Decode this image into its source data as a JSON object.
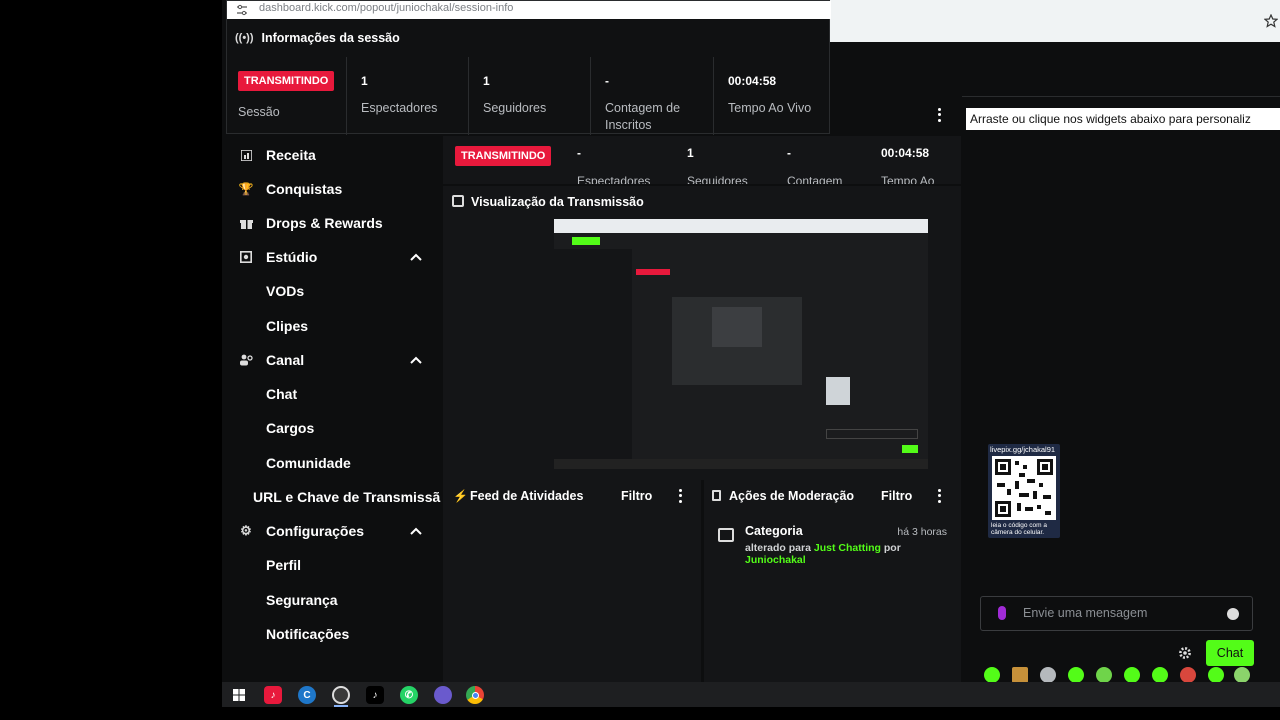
{
  "popup": {
    "url": "dashboard.kick.com/popout/juniochakal/session-info",
    "title": "Informações da sessão",
    "live_badge": "TRANSMITINDO",
    "session_label": "Sessão",
    "stats": [
      {
        "value": "1",
        "label": "Espectadores"
      },
      {
        "value": "1",
        "label": "Seguidores"
      },
      {
        "value": "-",
        "label": "Contagem de Inscritos"
      },
      {
        "value": "00:04:58",
        "label": "Tempo Ao Vivo"
      }
    ]
  },
  "sidebar": {
    "items": [
      {
        "label": "Receita",
        "icon": "chart-icon"
      },
      {
        "label": "Conquistas",
        "icon": "trophy-icon"
      },
      {
        "label": "Drops & Rewards",
        "icon": "gift-icon"
      },
      {
        "label": "Estúdio",
        "icon": "studio-icon"
      },
      {
        "label": "VODs"
      },
      {
        "label": "Clipes"
      },
      {
        "label": "Canal",
        "icon": "users-icon"
      },
      {
        "label": "Chat"
      },
      {
        "label": "Cargos"
      },
      {
        "label": "Comunidade"
      },
      {
        "label": "URL e Chave de Transmissã"
      },
      {
        "label": "Configurações",
        "icon": "gear-icon"
      },
      {
        "label": "Perfil"
      },
      {
        "label": "Segurança"
      },
      {
        "label": "Notificações"
      }
    ]
  },
  "session_row": {
    "live_badge": "TRANSMITINDO",
    "stats": [
      {
        "value": "-",
        "label": "Espectadores"
      },
      {
        "value": "1",
        "label": "Seguidores"
      },
      {
        "value": "-",
        "label": "Contagem"
      },
      {
        "value": "00:04:58",
        "label": "Tempo Ao"
      }
    ]
  },
  "preview": {
    "title": "Visualização da Transmissão"
  },
  "activity_feed": {
    "title": "Feed de Atividades",
    "filter_label": "Filtro"
  },
  "moderation": {
    "title": "Ações de Moderação",
    "filter_label": "Filtro",
    "event": {
      "title": "Categoria",
      "time": "há 3 horas",
      "prefix": "alterado para ",
      "category": "Just Chatting",
      "by": " por",
      "user": "Juniochakal"
    }
  },
  "chat": {
    "tooltip": "Arraste ou clique nos widgets abaixo para personaliz",
    "qr_title": "livepix.gg/jchakal91",
    "qr_caption": "leia o código com a câmera do celular.",
    "input_placeholder": "Envie uma mensagem",
    "send_label": "Chat"
  },
  "colors": {
    "kick_green": "#53fc18",
    "live_red": "#e8193c",
    "background": "#0d0e0f",
    "panel": "#141517"
  }
}
